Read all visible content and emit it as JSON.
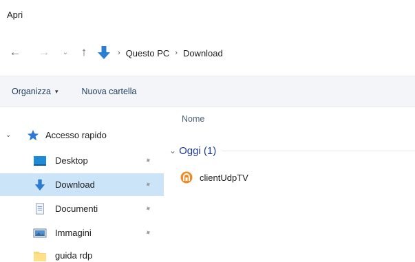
{
  "window": {
    "title": "Apri"
  },
  "nav": {
    "back": "←",
    "forward": "→",
    "recent": "⌄",
    "up": "↑"
  },
  "address": {
    "icon": "download-arrow-icon",
    "separator": "›",
    "crumbs": [
      "Questo PC",
      "Download"
    ]
  },
  "commands": {
    "organize_label": "Organizza",
    "organize_caret": "▾",
    "new_folder_label": "Nuova cartella"
  },
  "sidebar": {
    "quick_access": {
      "label": "Accesso rapido",
      "icon": "star-icon",
      "expander": "⌄"
    },
    "items": [
      {
        "label": "Desktop",
        "icon": "desktop-icon",
        "pinned": true
      },
      {
        "label": "Download",
        "icon": "download-arrow-icon",
        "pinned": true,
        "selected": true
      },
      {
        "label": "Documenti",
        "icon": "document-icon",
        "pinned": true
      },
      {
        "label": "Immagini",
        "icon": "images-icon",
        "pinned": true
      },
      {
        "label": "guida rdp",
        "icon": "folder-icon",
        "pinned": false
      }
    ],
    "pin_glyph": "📌"
  },
  "content": {
    "column_name": "Nome",
    "group_label": "Oggi (1)",
    "files": [
      {
        "name": "clientUdpTV",
        "icon": "java-app-icon"
      }
    ]
  },
  "colors": {
    "accent": "#1e3c96",
    "selected_bg": "#cce4f7",
    "command_bar_bg": "#f3f5f9",
    "download_blue": "#2b7cd3",
    "star_blue": "#2b79d6"
  }
}
